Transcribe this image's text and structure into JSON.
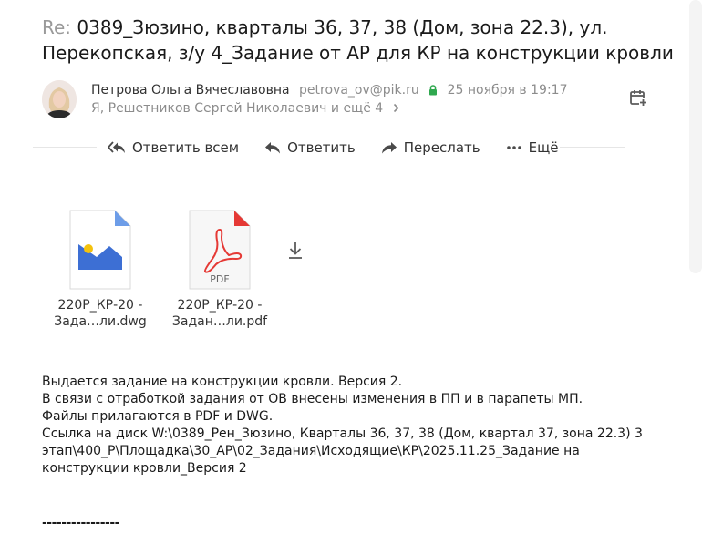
{
  "subject": {
    "prefix": "Re:",
    "line1": "0389_Зюзино, кварталы 36, 37, 38 (Дом, зона 22.3), ул.",
    "line2": "Перекопская, з/у 4_Задание от АР для КР на конструкции кровли"
  },
  "sender": {
    "name": "Петрова Ольга Вячеславовна",
    "email": "petrova_ov@pik.ru",
    "date": "25 ноября в 19:17",
    "recipients": "Я, Решетников Сергей Николаевич и ещё 4"
  },
  "toolbar": {
    "reply_all": "Ответить всем",
    "reply": "Ответить",
    "forward": "Переслать",
    "more": "Ещё"
  },
  "attachments": [
    {
      "line1": "220Р_КР-20 -",
      "line2": "Зада…ли.dwg",
      "type": "image",
      "icon": "image-file-icon",
      "color": "#3d6fd4"
    },
    {
      "line1": "220Р_КР-20 -",
      "line2": "Задан…ли.pdf",
      "type": "pdf",
      "icon": "pdf-file-icon",
      "label": "PDF",
      "color": "#e53935"
    }
  ],
  "body": {
    "lines": [
      "Выдается задание на конструкции кровли.  Версия 2.",
      "В связи с отработкой задания от ОВ внесены изменения в ПП и в парапеты МП.",
      "Файлы прилагаются в PDF и DWG.",
      "Ссылка на диск W:\\0389_Рен_Зюзино, Кварталы 36, 37, 38 (Дом, квартал 37, зона 22.3) 3",
      "этап\\400_Р\\Площадка\\30_АР\\02_Задания\\Исходящие\\КР\\2025.11.25_Задание на",
      "конструкции кровли_Версия 2"
    ],
    "separator": "----------------"
  },
  "colors": {
    "secure_lock": "#2fa84f",
    "muted_text": "#8c8c8c",
    "icon_gray": "#5c5c5c"
  }
}
